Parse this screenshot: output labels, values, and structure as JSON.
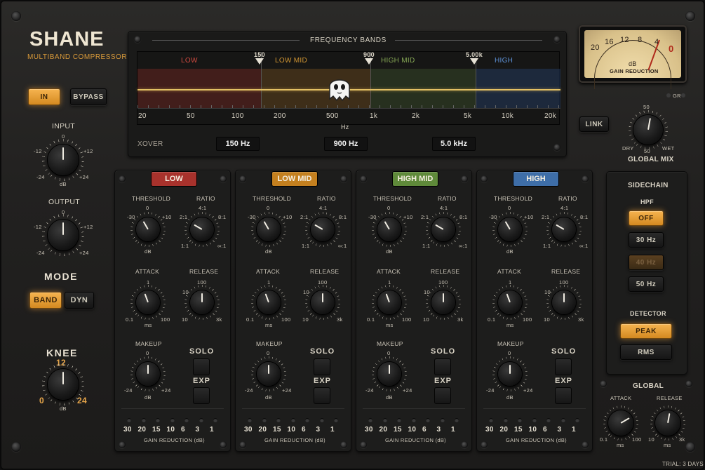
{
  "brand": {
    "title": "SHANE",
    "subtitle": "MULTIBAND COMPRESSOR"
  },
  "top_buttons": {
    "in": "IN",
    "bypass": "BYPASS",
    "link": "LINK"
  },
  "input": {
    "label": "INPUT",
    "zero": "0",
    "min": "-12",
    "max": "+12",
    "lo": "-24",
    "hi": "+24",
    "unit": "dB"
  },
  "output": {
    "label": "OUTPUT",
    "zero": "0",
    "min": "-12",
    "max": "+12",
    "lo": "-24",
    "hi": "+24",
    "unit": "dB"
  },
  "mode": {
    "label": "MODE",
    "band": "BAND",
    "dyn": "DYN"
  },
  "knee": {
    "label": "KNEE",
    "value": "12",
    "min": "0",
    "max": "24",
    "unit": "dB"
  },
  "freq_display": {
    "title": "FREQUENCY BANDS",
    "bands": [
      "LOW",
      "LOW MID",
      "HIGH MID",
      "HIGH"
    ],
    "band_colors": [
      "#c8413a",
      "#d29632",
      "#7fa350",
      "#5a8cd0"
    ],
    "crossover_markers": [
      "150",
      "900",
      "5.00k"
    ],
    "axis": [
      "20",
      "50",
      "100",
      "200",
      "500",
      "1k",
      "2k",
      "5k",
      "10k",
      "20k"
    ],
    "axis_unit": "Hz",
    "xover_label": "XOVER",
    "xover_values": [
      "150 Hz",
      "900 Hz",
      "5.0 kHz"
    ]
  },
  "meter": {
    "scale": [
      "20",
      "16",
      "12",
      "8",
      "4",
      "0"
    ],
    "unit": "dB",
    "caption": "GAIN REDUCTION",
    "gr": "GR"
  },
  "global_mix": {
    "zero": "50",
    "dry": "DRY",
    "mid": "50",
    "wet": "WET",
    "label": "GLOBAL MIX"
  },
  "band_common": {
    "threshold": "THRESHOLD",
    "thr_zero": "0",
    "thr_min": "-30",
    "thr_max": "+10",
    "thr_unit": "dB",
    "ratio": "RATIO",
    "ratio_top": "4:1",
    "ratio_l": "2:1",
    "ratio_r": "8:1",
    "ratio_bl": "1:1",
    "ratio_br": "∞:1",
    "attack": "ATTACK",
    "att_top": "1",
    "att_l": "0.1",
    "att_r": "100",
    "att_unit": "ms",
    "release": "RELEASE",
    "rel_top": "100",
    "rel_l": "10",
    "rel_l2": "10",
    "rel_r": "3k",
    "makeup": "MAKEUP",
    "mk_zero": "0",
    "mk_min": "-24",
    "mk_max": "+24",
    "mk_unit": "dB",
    "solo": "SOLO",
    "exp": "EXP",
    "gr_scale": [
      "30",
      "20",
      "15",
      "10",
      "6",
      "3",
      "1"
    ],
    "gr_caption": "GAIN REDUCTION (dB)"
  },
  "bands": [
    {
      "name": "LOW",
      "color": "#a8322c"
    },
    {
      "name": "LOW MID",
      "color": "#c4801f"
    },
    {
      "name": "HIGH MID",
      "color": "#5f8a3a"
    },
    {
      "name": "HIGH",
      "color": "#3e6ea8"
    }
  ],
  "sidechain": {
    "title": "SIDECHAIN",
    "hpf": "HPF",
    "options": [
      "OFF",
      "30 Hz",
      "40 Hz",
      "50 Hz"
    ],
    "detector": "DETECTOR",
    "peak": "PEAK",
    "rms": "RMS"
  },
  "global": {
    "title": "GLOBAL",
    "attack": "ATTACK",
    "release": "RELEASE",
    "att_l": "0.1",
    "att_r": "100",
    "att_unit": "ms",
    "rel_l": "10",
    "rel_r": "3k",
    "rel_unit": "ms"
  },
  "trial": "TRIAL: 3 DAYS"
}
